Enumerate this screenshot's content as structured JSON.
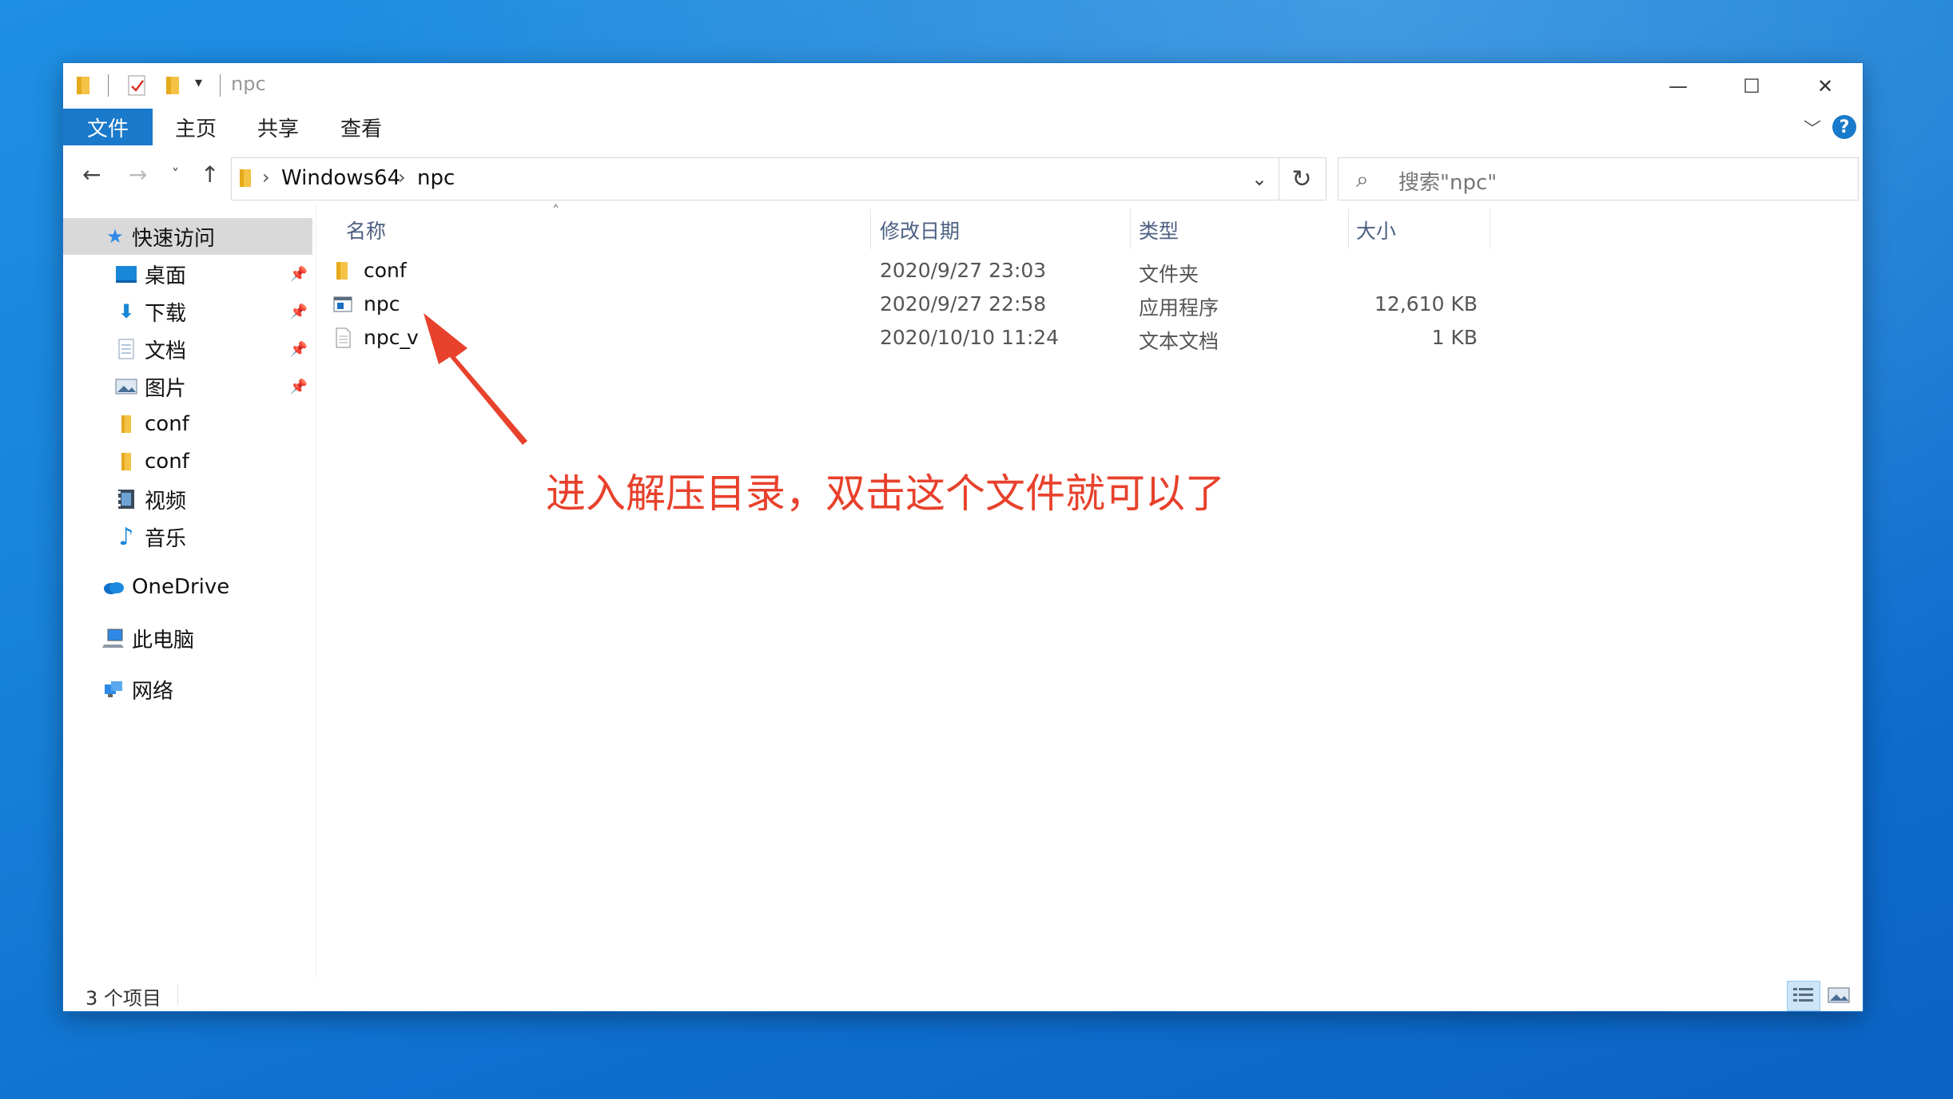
{
  "window": {
    "title": "npc",
    "controls": {
      "minimize": "—",
      "maximize": "☐",
      "close": "✕"
    }
  },
  "ribbon": {
    "file_tab": "文件",
    "tabs": [
      "主页",
      "共享",
      "查看"
    ],
    "expand_icon": "chevron-down-icon",
    "help_label": "?"
  },
  "address": {
    "breadcrumbs": [
      "Windows64",
      "npc"
    ],
    "search_placeholder": "搜索\"npc\""
  },
  "nav": {
    "quick_access": "快速访问",
    "items": [
      {
        "label": "桌面",
        "icon": "desktop-icon",
        "pinned": true
      },
      {
        "label": "下载",
        "icon": "download-icon",
        "pinned": true
      },
      {
        "label": "文档",
        "icon": "document-icon",
        "pinned": true
      },
      {
        "label": "图片",
        "icon": "pictures-icon",
        "pinned": true
      },
      {
        "label": "conf",
        "icon": "folder-icon",
        "pinned": false
      },
      {
        "label": "conf",
        "icon": "folder-icon",
        "pinned": false
      },
      {
        "label": "视频",
        "icon": "video-icon",
        "pinned": false
      },
      {
        "label": "音乐",
        "icon": "music-icon",
        "pinned": false
      }
    ],
    "onedrive": "OneDrive",
    "this_pc": "此电脑",
    "network": "网络"
  },
  "columns": {
    "name": "名称",
    "modified": "修改日期",
    "type": "类型",
    "size": "大小"
  },
  "files": [
    {
      "name": "conf",
      "modified": "2020/9/27 23:03",
      "type": "文件夹",
      "size": "",
      "icon": "folder-icon"
    },
    {
      "name": "npc",
      "modified": "2020/9/27 22:58",
      "type": "应用程序",
      "size": "12,610 KB",
      "icon": "application-icon"
    },
    {
      "name": "npc_",
      "name_tail": "v",
      "modified": "2020/10/10 11:24",
      "type": "文本文档",
      "size": "1 KB",
      "icon": "text-file-icon"
    }
  ],
  "status": {
    "item_count": "3 个项目"
  },
  "annotation": {
    "text": "进入解压目录，双击这个文件就可以了",
    "color": "#e8412c"
  }
}
